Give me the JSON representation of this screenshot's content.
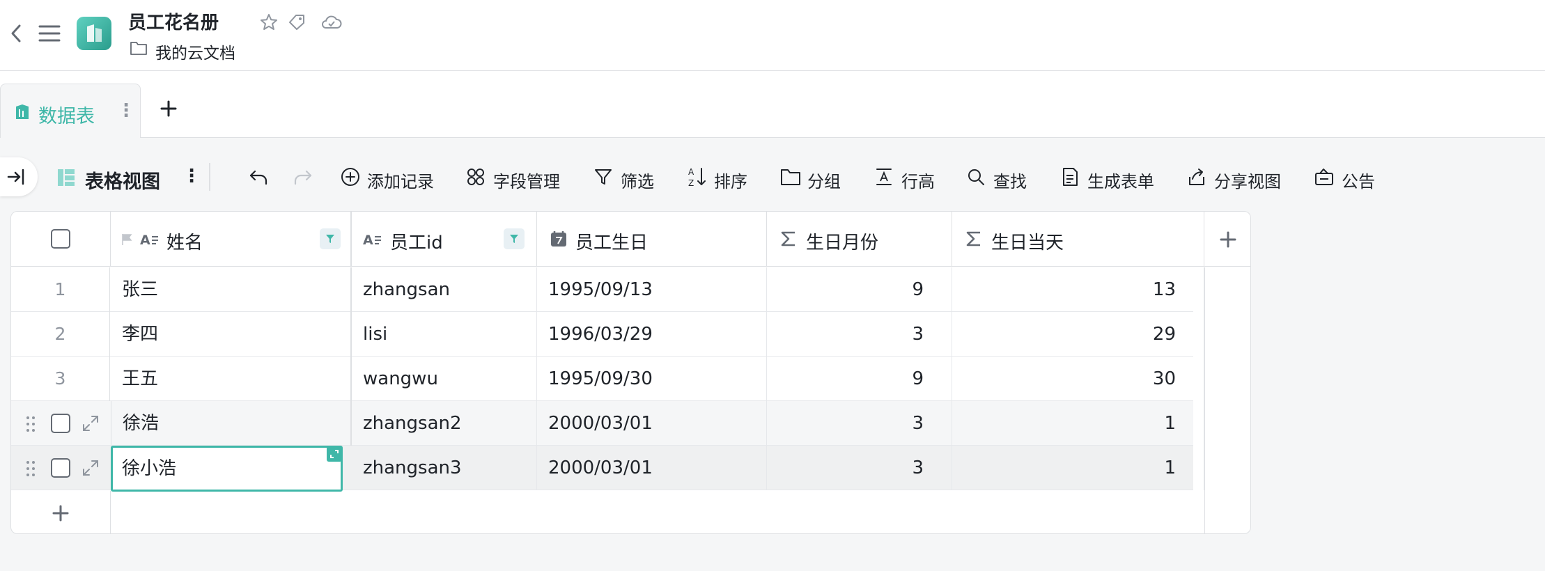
{
  "header": {
    "title": "员工花名册",
    "path": "我的云文档"
  },
  "tabs": [
    {
      "label": "数据表"
    }
  ],
  "toolbar": {
    "view_name": "表格视图",
    "items": [
      {
        "label": "添加记录",
        "icon": "plus-circle-icon"
      },
      {
        "label": "字段管理",
        "icon": "fields-icon"
      },
      {
        "label": "筛选",
        "icon": "filter-icon"
      },
      {
        "label": "排序",
        "icon": "sort-icon"
      },
      {
        "label": "分组",
        "icon": "folder-icon"
      },
      {
        "label": "行高",
        "icon": "row-height-icon"
      },
      {
        "label": "查找",
        "icon": "search-icon"
      },
      {
        "label": "生成表单",
        "icon": "form-icon"
      },
      {
        "label": "分享视图",
        "icon": "share-icon"
      },
      {
        "label": "公告",
        "icon": "announcement-icon"
      }
    ]
  },
  "table": {
    "columns": [
      {
        "label": "姓名",
        "icon": "text-field-icon",
        "filtered": true
      },
      {
        "label": "员工id",
        "icon": "text-field-icon",
        "filtered": true
      },
      {
        "label": "员工生日",
        "icon": "date-field-icon",
        "filtered": false
      },
      {
        "label": "生日月份",
        "icon": "formula-icon",
        "filtered": false
      },
      {
        "label": "生日当天",
        "icon": "formula-icon",
        "filtered": false
      }
    ],
    "rows": [
      {
        "index": "1",
        "name": "张三",
        "id": "zhangsan",
        "birthday": "1995/09/13",
        "month": "9",
        "day": "13"
      },
      {
        "index": "2",
        "name": "李四",
        "id": "lisi",
        "birthday": "1996/03/29",
        "month": "3",
        "day": "29"
      },
      {
        "index": "3",
        "name": "王五",
        "id": "wangwu",
        "birthday": "1995/09/30",
        "month": "9",
        "day": "30"
      },
      {
        "index": "",
        "name": "徐浩",
        "id": "zhangsan2",
        "birthday": "2000/03/01",
        "month": "3",
        "day": "1"
      },
      {
        "index": "",
        "name": "徐小浩",
        "id": "zhangsan3",
        "birthday": "2000/03/01",
        "month": "3",
        "day": "1"
      }
    ]
  },
  "colors": {
    "accent": "#3fb7a8",
    "text": "#1f2329",
    "muted": "#8f959e",
    "border": "#dee0e3"
  }
}
